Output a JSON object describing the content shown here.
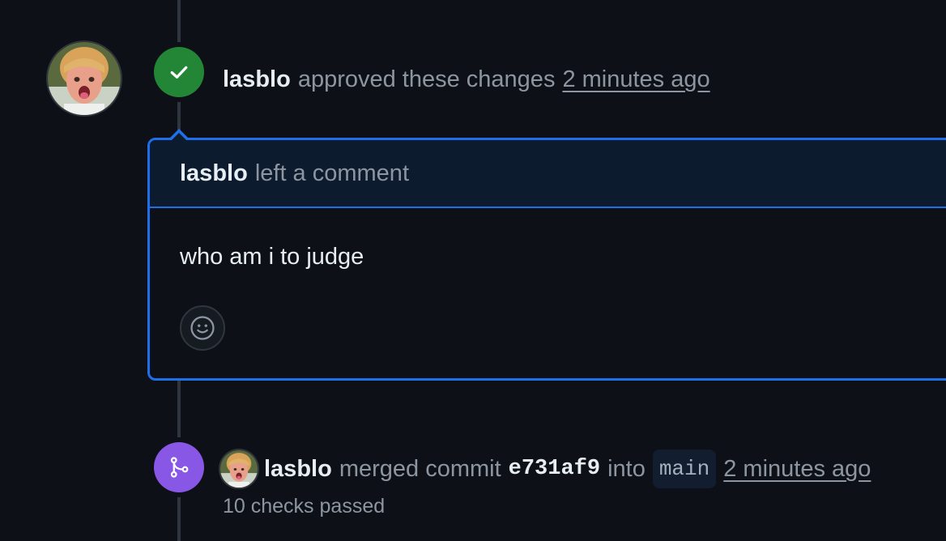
{
  "colors": {
    "background": "#0d1117",
    "approved_badge": "#238636",
    "merged_badge": "#8957e5",
    "comment_border": "#1f6feb",
    "comment_header_bg": "#0c1b2e",
    "text_primary": "#e6edf3",
    "text_muted": "#8d96a0"
  },
  "review_event": {
    "badge_icon": "check-icon",
    "author": "lasblo",
    "action": "approved these changes",
    "timestamp": "2 minutes ago"
  },
  "comment": {
    "author": "lasblo",
    "action": "left a comment",
    "body": "who am i to judge",
    "reaction_icon": "smiley-icon"
  },
  "merge_event": {
    "badge_icon": "git-merge-icon",
    "author": "lasblo",
    "action": "merged commit",
    "commit_sha": "e731af9",
    "into": "into",
    "branch": "main",
    "timestamp": "2 minutes ago",
    "checks": "10 checks passed"
  }
}
